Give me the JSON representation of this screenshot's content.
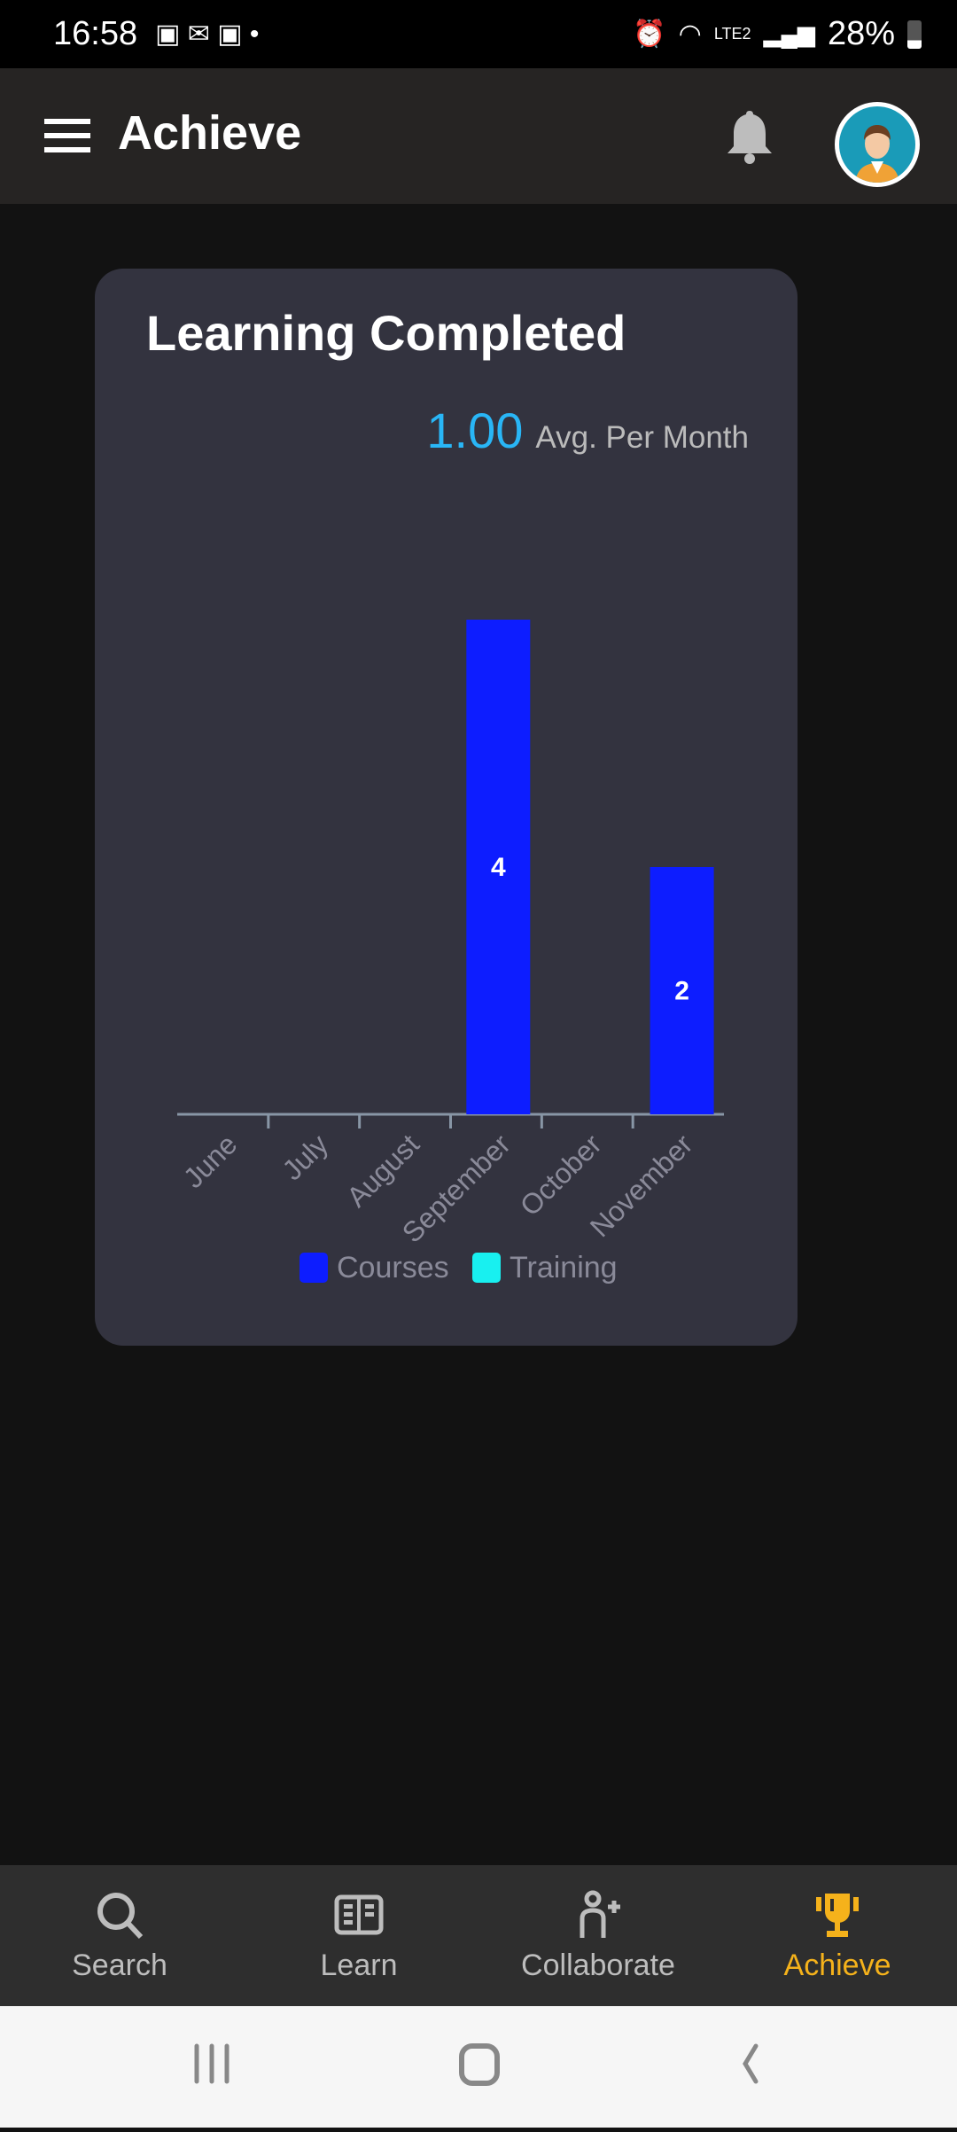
{
  "status_bar": {
    "time": "16:58",
    "battery": "28%",
    "network": "LTE2"
  },
  "header": {
    "title": "Achieve",
    "menu_icon": "hamburger-icon",
    "bell_icon": "bell-icon",
    "avatar_icon": "avatar"
  },
  "card": {
    "title": "Learning Completed",
    "avg_value": "1.00",
    "avg_label": "Avg. Per Month"
  },
  "chart_data": {
    "type": "bar",
    "categories": [
      "June",
      "July",
      "August",
      "September",
      "October",
      "November"
    ],
    "series": [
      {
        "name": "Courses",
        "color": "#0d1dff",
        "values": [
          0,
          0,
          0,
          4,
          0,
          2
        ]
      },
      {
        "name": "Training",
        "color": "#18f0f0",
        "values": [
          0,
          0,
          0,
          0,
          0,
          0
        ]
      }
    ],
    "data_labels": [
      "",
      "",
      "",
      "4",
      "",
      "2"
    ],
    "ylim": [
      0,
      4.6
    ],
    "grid": false,
    "legend": "bottom"
  },
  "bottom_nav": [
    {
      "label": "Search",
      "icon": "search-icon"
    },
    {
      "label": "Learn",
      "icon": "book-icon"
    },
    {
      "label": "Collaborate",
      "icon": "add-person-icon"
    },
    {
      "label": "Achieve",
      "icon": "trophy-icon",
      "active": true
    }
  ],
  "colors": {
    "accent": "#f5b21b",
    "avg": "#29b6f6",
    "card": "#33333f"
  }
}
